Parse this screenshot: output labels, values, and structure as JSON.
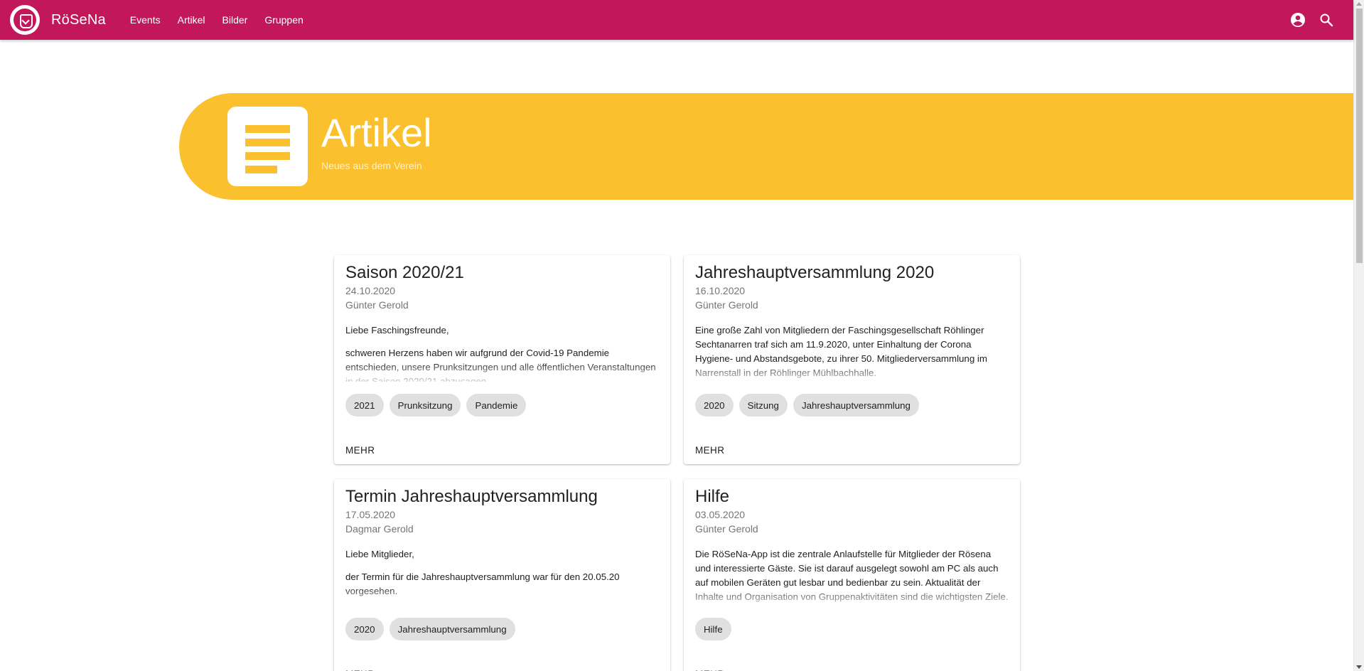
{
  "app": {
    "brand": "RöSeNa",
    "nav": [
      {
        "label": "Events"
      },
      {
        "label": "Artikel"
      },
      {
        "label": "Bilder"
      },
      {
        "label": "Gruppen"
      }
    ],
    "colors": {
      "primary": "#c2185b",
      "accent": "#fbc02d"
    },
    "icons": {
      "account": "account-circle-icon",
      "search": "search-icon"
    }
  },
  "hero": {
    "title": "Artikel",
    "subtitle": "Neues aus dem Verein",
    "icon": "article-lines-icon"
  },
  "articles": [
    {
      "title": "Saison 2020/21",
      "date": "24.10.2020",
      "author": "Günter Gerold",
      "paragraphs": [
        "Liebe Faschingsfreunde,",
        "schweren Herzens haben wir aufgrund der Covid-19 Pandemie entschieden, unsere Prunksitzungen und alle öffentlichen Veranstaltungen in der Saison 2020/21 abzusagen."
      ],
      "tags": [
        "2021",
        "Prunksitzung",
        "Pandemie"
      ],
      "action": "MEHR"
    },
    {
      "title": "Jahreshauptversammlung 2020",
      "date": "16.10.2020",
      "author": "Günter Gerold",
      "paragraphs": [
        "Eine große Zahl von Mitgliedern der Faschingsgesellschaft Röhlinger Sechtanarren traf sich am 11.9.2020, unter Einhaltung der Corona Hygiene- und Abstandsgebote, zu ihrer 50. Mitgliederversammlung im Narrenstall in der Röhlinger Mühlbachhalle."
      ],
      "tags": [
        "2020",
        "Sitzung",
        "Jahreshauptversammlung"
      ],
      "action": "MEHR"
    },
    {
      "title": "Termin Jahreshauptversammlung",
      "date": "17.05.2020",
      "author": "Dagmar Gerold",
      "paragraphs": [
        "Liebe Mitglieder,",
        "der Termin für die Jahreshauptversammlung war für den 20.05.20 vorgesehen."
      ],
      "tags": [
        "2020",
        "Jahreshauptversammlung"
      ],
      "action": "MEHR"
    },
    {
      "title": "Hilfe",
      "date": "03.05.2020",
      "author": "Günter Gerold",
      "paragraphs": [
        "Die RöSeNa-App ist die zentrale Anlaufstelle für Mitglieder der Rösena und interessierte Gäste. Sie ist darauf ausgelegt sowohl am PC als auch auf mobilen Geräten gut lesbar und bedienbar zu sein. Aktualität der Inhalte und Organisation von Gruppenaktivitäten sind die wichtigsten Ziele."
      ],
      "tags": [
        "Hilfe"
      ],
      "action": "MEHR"
    }
  ]
}
